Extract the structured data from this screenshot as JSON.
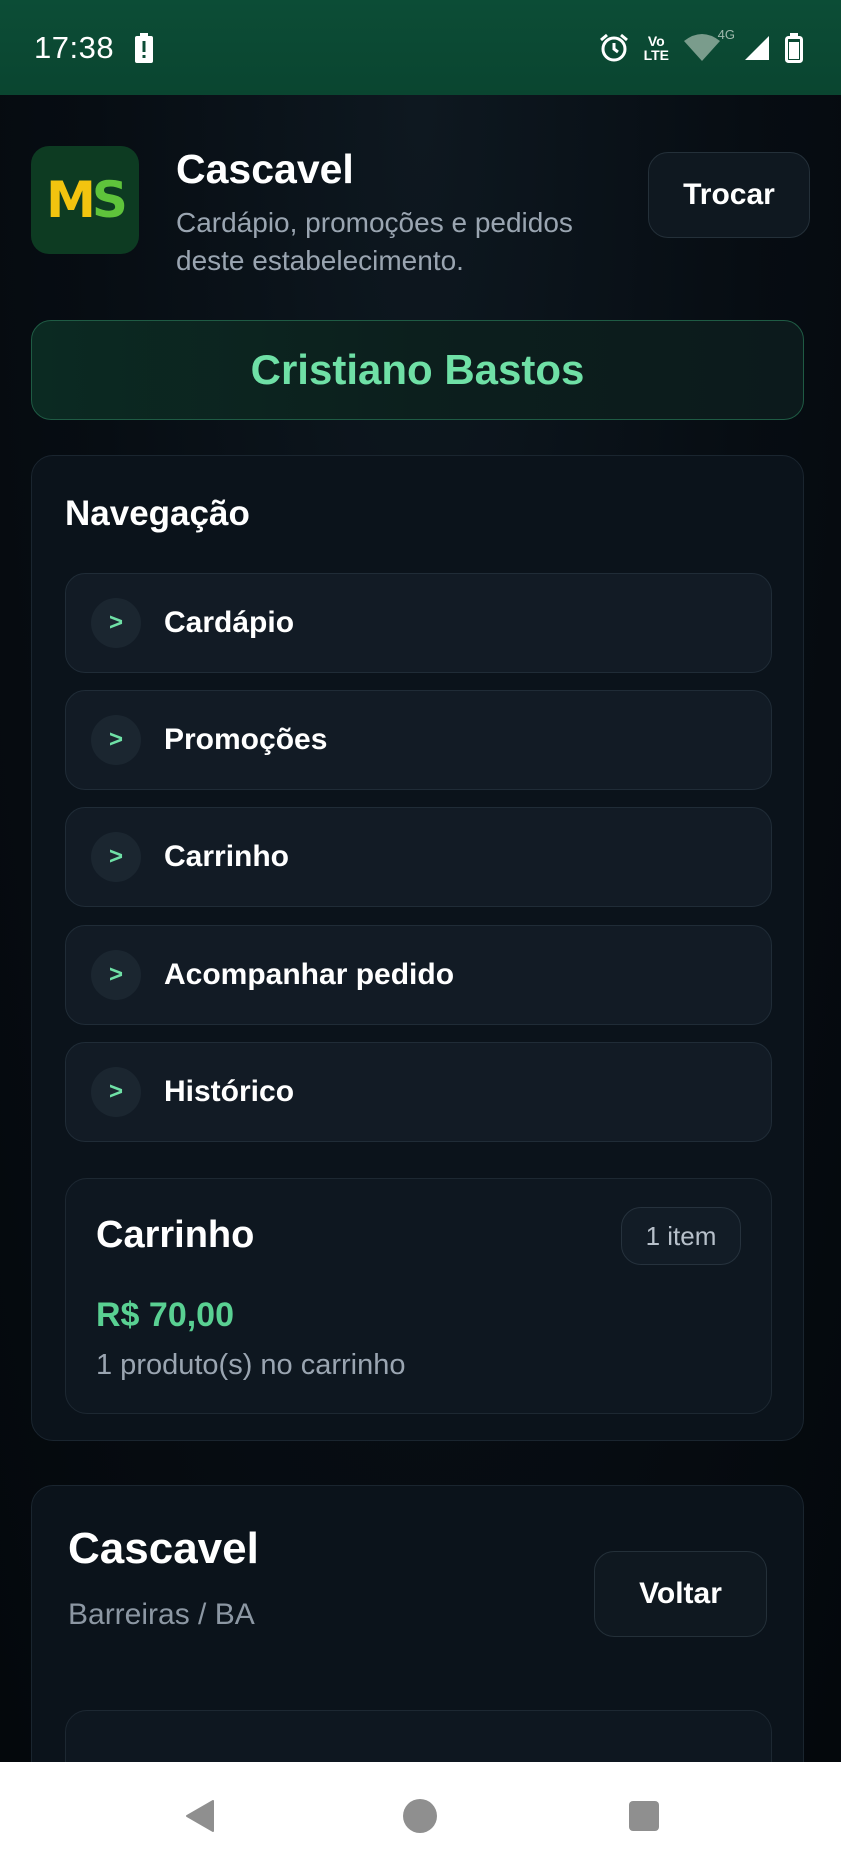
{
  "status_bar": {
    "time": "17:38",
    "icons": [
      "battery-alert-icon",
      "alarm-icon",
      "volte-icon",
      "wifi-icon",
      "signal-icon",
      "battery-icon"
    ],
    "network_label": "4G",
    "volte_top": "Vo",
    "volte_bottom": "LTE"
  },
  "header": {
    "logo_letters_1": "M",
    "logo_letters_2": "S",
    "store_name": "Cascavel",
    "description": "Cardápio, promoções e pedidos deste estabelecimento.",
    "switch_button": "Trocar"
  },
  "user": {
    "name": "Cristiano Bastos"
  },
  "navigation": {
    "title": "Navegação",
    "items": [
      {
        "label": "Cardápio",
        "icon": "chevron-right-icon"
      },
      {
        "label": "Promoções",
        "icon": "chevron-right-icon"
      },
      {
        "label": "Carrinho",
        "icon": "chevron-right-icon"
      },
      {
        "label": "Acompanhar pedido",
        "icon": "chevron-right-icon"
      },
      {
        "label": "Histórico",
        "icon": "chevron-right-icon"
      }
    ],
    "chevron_glyph": ">"
  },
  "cart": {
    "title": "Carrinho",
    "badge": "1 item",
    "total": "R$ 70,00",
    "summary": "1 produto(s) no carrinho"
  },
  "location": {
    "title": "Cascavel",
    "subtitle": "Barreiras / BA",
    "back_button": "Voltar"
  },
  "colors": {
    "accent": "#6fe0a6",
    "price": "#59d092",
    "status_bar": "#0c4d36"
  }
}
